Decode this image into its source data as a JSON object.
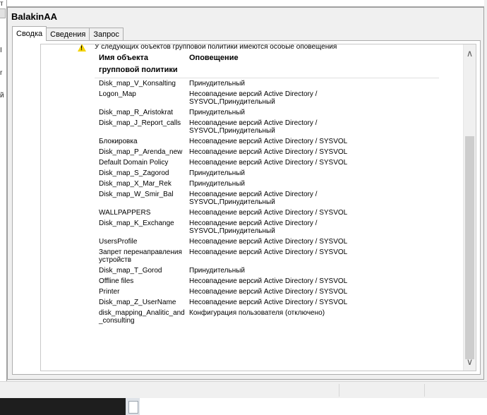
{
  "window": {
    "title": "BalakinAA"
  },
  "left_strip": {
    "chars": [
      "т",
      "I",
      "r",
      "й"
    ]
  },
  "tabs": [
    {
      "label": "Сводка",
      "active": true
    },
    {
      "label": "Сведения",
      "active": false
    },
    {
      "label": "Запрос",
      "active": false
    }
  ],
  "notice": {
    "text": "У следующих объектов групповой политики имеются особые оповещения",
    "icon": "warning-icon"
  },
  "table": {
    "headers": {
      "name": "Имя объекта групповой политики",
      "alert": "Оповещение"
    },
    "rows": [
      {
        "name": "Disk_map_V_Konsalting",
        "alert": "Принудительный"
      },
      {
        "name": "Logon_Map",
        "alert": "Несовпадение версий Active Directory / SYSVOL,Принудительный"
      },
      {
        "name": "Disk_map_R_Aristokrat",
        "alert": "Принудительный"
      },
      {
        "name": "Disk_map_J_Report_calls",
        "alert": "Несовпадение версий Active Directory / SYSVOL,Принудительный"
      },
      {
        "name": "Блокировка",
        "alert": "Несовпадение версий Active Directory / SYSVOL"
      },
      {
        "name": "Disk_map_P_Arenda_new",
        "alert": "Несовпадение версий Active Directory / SYSVOL"
      },
      {
        "name": "Default Domain Policy",
        "alert": "Несовпадение версий Active Directory / SYSVOL"
      },
      {
        "name": "Disk_map_S_Zagorod",
        "alert": "Принудительный"
      },
      {
        "name": "Disk_map_X_Mar_Rek",
        "alert": "Принудительный"
      },
      {
        "name": "Disk_map_W_Smir_Bal",
        "alert": "Несовпадение версий Active Directory / SYSVOL,Принудительный"
      },
      {
        "name": "WALLPAPPERS",
        "alert": "Несовпадение версий Active Directory / SYSVOL"
      },
      {
        "name": "Disk_map_K_Exchange",
        "alert": "Несовпадение версий Active Directory / SYSVOL,Принудительный"
      },
      {
        "name": "UsersProfile",
        "alert": "Несовпадение версий Active Directory / SYSVOL"
      },
      {
        "name": "Запрет перенаправления устройств",
        "alert": "Несовпадение версий Active Directory / SYSVOL"
      },
      {
        "name": "Disk_map_T_Gorod",
        "alert": "Принудительный"
      },
      {
        "name": "Offline files",
        "alert": "Несовпадение версий Active Directory / SYSVOL"
      },
      {
        "name": "Printer",
        "alert": "Несовпадение версий Active Directory / SYSVOL"
      },
      {
        "name": "Disk_map_Z_UserName",
        "alert": "Несовпадение версий Active Directory / SYSVOL"
      },
      {
        "name": "disk_mapping_Analitic_and _consulting",
        "alert": "Конфигурация пользователя (отключено)"
      }
    ]
  },
  "scrollbar": {
    "up_arrow": "chevron-up-icon",
    "down_arrow": "chevron-down-icon"
  },
  "colors": {
    "warning": "#f5d400",
    "background": "#f0f0f0",
    "taskbar": "#1e1e1e"
  }
}
